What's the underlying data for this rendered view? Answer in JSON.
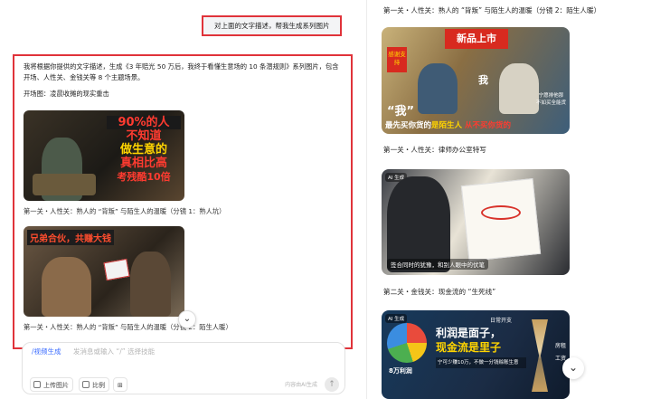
{
  "chat": {
    "user_message": "对上面的文字描述，帮我生成系列图片",
    "answer_intro": "我将根据你提供的文字描述，生成《3 年赔光 50 万后，我终于看懂生意场的 10 条潜规则》系列图片，包含开场、人性关、金钱关等 8 个主题场景。",
    "scene_label": "开场图：凌晨收摊的现实重击",
    "image1_overlay_line1": "90%的人",
    "image1_overlay_line2": "不知道",
    "image1_overlay_line3": "做生意的",
    "image1_overlay_line4": "真相比高",
    "image1_overlay_line5": "考残酷10倍",
    "caption1": "第一关・人性关：熟人的 “背叛” 与陌生人的温暖（分镜 1：熟人坑）",
    "image2_overlay": "兄弟合伙，共赚大钱",
    "caption2": "第一关・人性关：熟人的 “背叛” 与陌生人的温暖（分镜 2：陌生人暖）",
    "scroll_icon": "chevron-down-icon"
  },
  "composer": {
    "hint_mode": "/视频生成",
    "hint_placeholder": "发消息或输入 “/” 选择技能",
    "chip_upload": "上传图片",
    "chip_ratio": "比例",
    "count_text": "内容由AI生成",
    "send_icon": "send-arrow-icon"
  },
  "preview": {
    "title1": "第一关・人性关：熟人的 “背叛” 与陌生人的温暖（分镜 2：陌生人暖）",
    "img1_sign": "新品上市",
    "img1_badge": "感谢支持",
    "img1_word": "我",
    "img1_quote": "“我”",
    "img1_subtitle_a": "最先买你货的",
    "img1_subtitle_b": "是陌生人",
    "img1_subtitle_c": "从不买你货的",
    "img1_side": "宁愿排他那",
    "img1_side2": "不如买全能货",
    "title2": "第一关・人性关：律师办公室特写",
    "img2_tag": "AI 生成",
    "img2_caption": "签合同时的犹豫，和别人眼中的伏笔",
    "title3": "第二关・金钱关：现金流的 “生死线”",
    "img3_tag": "AI 生成",
    "img3_line1": "利润是面子，",
    "img3_line2": "现金流是里子",
    "img3_small": "日常开支",
    "img3_pie": "8万利润",
    "img3_note": "宁可少赚10万，不做一分钱赊账生意",
    "img3_right1": "房租",
    "img3_right2": "工资",
    "scroll_icon": "chevron-down-icon"
  },
  "colors": {
    "highlight_border": "#e0333a",
    "accent_blue": "#3b6cff"
  }
}
